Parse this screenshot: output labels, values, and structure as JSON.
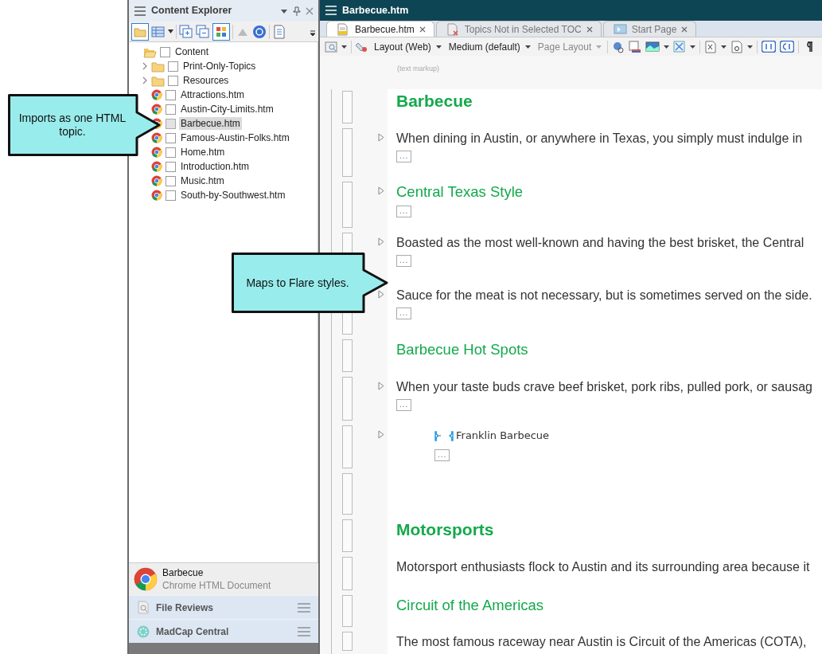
{
  "callouts": [
    {
      "text": "Imports as one HTML topic."
    },
    {
      "text": "Maps to Flare styles."
    }
  ],
  "explorer": {
    "title": "Content Explorer",
    "tree": [
      {
        "label": "Content",
        "kind": "folder",
        "checked": false,
        "expanded": true,
        "selected": false,
        "children": [
          {
            "label": "Print-Only-Topics",
            "kind": "folder",
            "checked": false,
            "expanded": false,
            "selected": false
          },
          {
            "label": "Resources",
            "kind": "folder",
            "checked": false,
            "expanded": false,
            "selected": false
          },
          {
            "label": "Attractions.htm",
            "kind": "file",
            "checked": false,
            "selected": false
          },
          {
            "label": "Austin-City-Limits.htm",
            "kind": "file",
            "checked": false,
            "selected": false
          },
          {
            "label": "Barbecue.htm",
            "kind": "file",
            "checked": false,
            "selected": true
          },
          {
            "label": "Famous-Austin-Folks.htm",
            "kind": "file",
            "checked": false,
            "selected": false
          },
          {
            "label": "Home.htm",
            "kind": "file",
            "checked": false,
            "selected": false
          },
          {
            "label": "Introduction.htm",
            "kind": "file",
            "checked": false,
            "selected": false
          },
          {
            "label": "Music.htm",
            "kind": "file",
            "checked": false,
            "selected": false
          },
          {
            "label": "South-by-Southwest.htm",
            "kind": "file",
            "checked": false,
            "selected": false
          }
        ]
      }
    ]
  },
  "preview": {
    "name": "Barbecue",
    "type": "Chrome HTML Document"
  },
  "accordion": [
    {
      "label": "File Reviews",
      "kind": "reviews"
    },
    {
      "label": "MadCap Central",
      "kind": "central"
    }
  ],
  "editor": {
    "title": "Barbecue.htm",
    "tabs": [
      {
        "label": "Barbecue.htm",
        "kind": "topic",
        "selected": true
      },
      {
        "label": "Topics Not in Selected TOC",
        "kind": "report",
        "selected": false
      },
      {
        "label": "Start Page",
        "kind": "start",
        "selected": false
      }
    ],
    "dropdowns": [
      {
        "label": "Layout (Web)",
        "disabled": false
      },
      {
        "label": "Medium (default)",
        "disabled": false
      },
      {
        "label": "Page Layout",
        "disabled": true
      }
    ],
    "markup_hint": "(text markup)",
    "blocks": [
      {
        "kind": "heading1",
        "text": "Barbecue",
        "expander": false
      },
      {
        "kind": "para",
        "text": "When dining in Austin, or anywhere in Texas, you simply must indulge in",
        "expander": true,
        "marker": "..."
      },
      {
        "kind": "heading2",
        "text": "Central Texas Style",
        "expander": true,
        "marker": "..."
      },
      {
        "kind": "para",
        "text": "Boasted as the most well-known and having the best brisket, the Central",
        "expander": true,
        "marker": "..."
      },
      {
        "kind": "para",
        "text": "Sauce for the meat is not necessary, but is sometimes served on the side.",
        "expander": true,
        "marker": "..."
      },
      {
        "kind": "heading2",
        "text": "Barbecue Hot Spots",
        "expander": false
      },
      {
        "kind": "para",
        "text": "When your taste buds crave beef brisket, pork ribs, pulled pork, or sausag",
        "expander": true,
        "marker": "..."
      },
      {
        "kind": "listitem",
        "text": "Franklin Barbecue",
        "expander": true,
        "marker": "..."
      },
      {
        "kind": "spacer",
        "expander": false
      },
      {
        "kind": "heading1",
        "text": "Motorsports",
        "expander": false
      },
      {
        "kind": "para",
        "text": "Motorsport enthusiasts flock to Austin and its surrounding area because it",
        "expander": false
      },
      {
        "kind": "heading2",
        "text": "Circuit of the Americas",
        "expander": false
      },
      {
        "kind": "para",
        "text": "The most famous raceway near Austin is Circuit of the Americas (COTA),",
        "expander": false
      }
    ]
  }
}
